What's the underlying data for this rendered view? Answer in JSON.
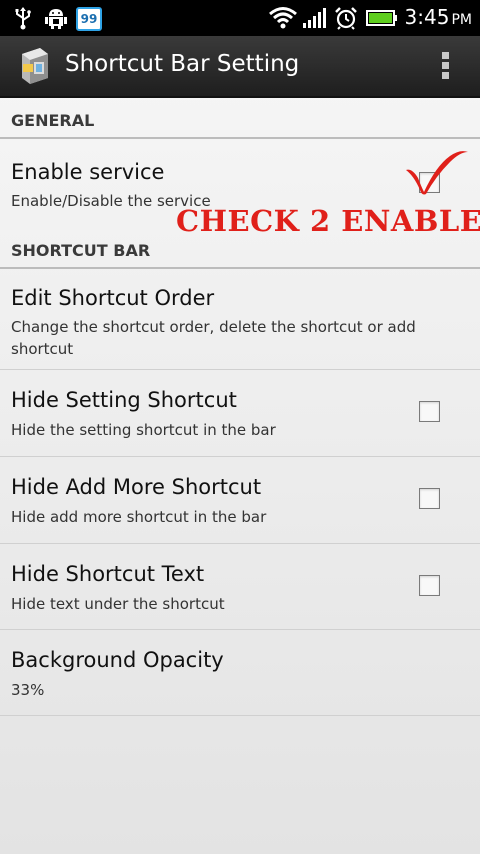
{
  "status_bar": {
    "notification_count": "99",
    "time": "3:45",
    "ampm": "PM",
    "icons": [
      "usb-icon",
      "android-debug-icon",
      "notification-badge",
      "wifi-icon",
      "signal-icon",
      "alarm-icon",
      "battery-icon"
    ],
    "battery_color": "#5fcf1f"
  },
  "action_bar": {
    "title": "Shortcut Bar Setting",
    "overflow_icon": "overflow-menu-icon"
  },
  "sections": {
    "general": {
      "header": "GENERAL",
      "items": [
        {
          "title": "Enable service",
          "summary": "Enable/Disable the service",
          "checked": false
        }
      ]
    },
    "shortcut_bar": {
      "header": "SHORTCUT BAR",
      "items": [
        {
          "title": "Edit Shortcut Order",
          "summary": "Change the shortcut order, delete the shortcut or add shortcut"
        },
        {
          "title": "Hide Setting Shortcut",
          "summary": "Hide the setting shortcut in the bar",
          "checked": false
        },
        {
          "title": "Hide Add More Shortcut",
          "summary": "Hide add more shortcut in the bar",
          "checked": false
        },
        {
          "title": "Hide Shortcut Text",
          "summary": "Hide text under the shortcut",
          "checked": false
        },
        {
          "title": "Background Opacity",
          "summary": "33%"
        }
      ]
    }
  },
  "annotation": {
    "text": "CHECK 2 ENABLE",
    "color": "#e0201a"
  }
}
